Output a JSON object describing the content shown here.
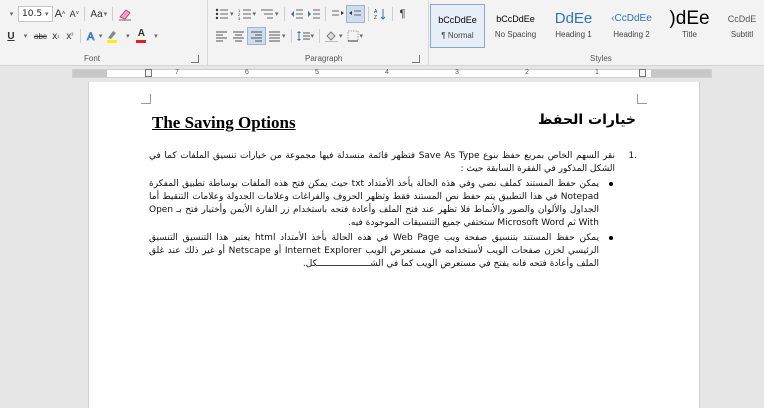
{
  "ribbon": {
    "font_group": {
      "label": "Font",
      "font_size": "10.5",
      "grow_font": "A",
      "shrink_font": "A",
      "change_case": "Aa",
      "underline": "U",
      "strikethrough": "abc",
      "subscript": "x",
      "superscript": "x"
    },
    "paragraph_group": {
      "label": "Paragraph"
    },
    "styles_group": {
      "label": "Styles",
      "styles": [
        {
          "sample": "bCcDdEe",
          "name": "¶ Normal"
        },
        {
          "sample": "bCcDdEe",
          "name": "No Spacing"
        },
        {
          "sample": "DdEe",
          "name": "Heading 1"
        },
        {
          "sample": "‹CcDdEe",
          "name": "Heading 2"
        },
        {
          "sample": ")dEe",
          "name": "Title"
        },
        {
          "sample": "CcDdE",
          "name": "Subtitl"
        }
      ]
    }
  },
  "ruler": {
    "numbers_left": [
      "7",
      "6",
      "5",
      "4",
      "3",
      "2",
      "1"
    ]
  },
  "document": {
    "title_en": "The  Saving Options",
    "title_ar": "خيارات الحفظ",
    "item1_number": ".1",
    "item1_text": "نقر السهم الخاص بمربع حفظ بنوع Save As Type فتظهر قائمة منسدلة فيها مجموعة من خيارات تنسيق الملفات كما في الشكل المذكور في الفقرة السابقة حيث :",
    "bullet1_text": "يمكن حفظ المستند كملف نصي وفي هذه الحالة يأخذ الأمتداد txt حيث يمكن فتح هذه الملفات بوساطة تطبيق المفكرة Notepad في هذا التطبيق يتم حفظ نص المستند فقط وتظهر الحروف والفراغات وعلامات الجدولة وعلامات التنقيط أما الجداول والألوان والصور والأنماط فلا تظهر عند فتح الملف وأعادة فتحه باستخدام زر الفارة الأيمن وأختيار فتح بـ Open With ثم Microsoft Word ستختفي جميع التنسيقات الموجودة فيه.",
    "bullet2_text": "يمكن حفظ المستند بتنسيق صفحة ويب Web Page في هذه الحالة يأخذ الأمتداد html يعتبر هذا التنسيق التنسيق الرئيسي لخزن صفحات الويب لأستخدامه في مستعرض الويب Internet Explorer أو Netscape أو غير ذلك عند غلق الملف وأعادة فتحه فانه يفتح في مستعرض الويب كما في الشــــــــــــــــــــكل."
  }
}
